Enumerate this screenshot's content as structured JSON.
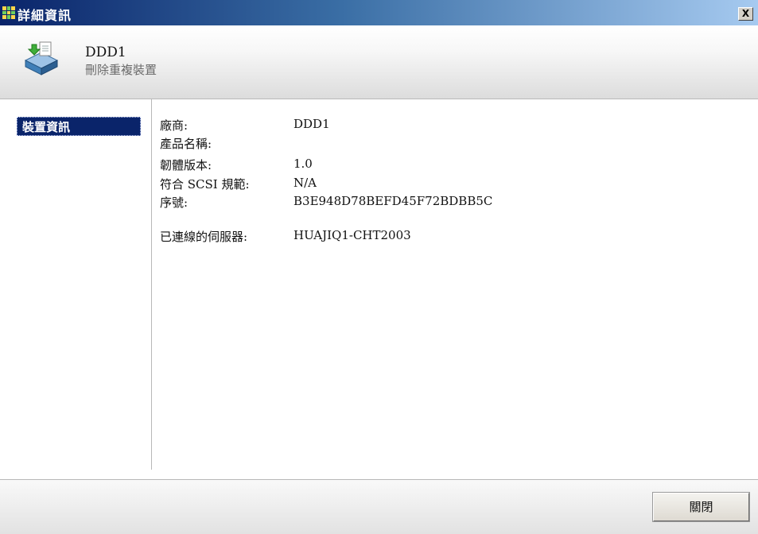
{
  "window": {
    "title": "詳細資訊",
    "close_label": "X"
  },
  "header": {
    "device_name": "DDD1",
    "device_type": "刪除重複裝置",
    "icon": "storage-device-icon"
  },
  "sidebar": {
    "items": [
      {
        "label": "裝置資訊",
        "selected": true
      }
    ]
  },
  "details": {
    "vendor_label": "廠商:",
    "vendor_value": "DDD1",
    "product_label": "產品名稱:",
    "product_value": "",
    "firmware_label": "韌體版本:",
    "firmware_value": "1.0",
    "scsi_label": "符合 SCSI 規範:",
    "scsi_value": "N/A",
    "serial_label": "序號:",
    "serial_value": "B3E948D78BEFD45F72BDBB5C",
    "server_label": "已連線的伺服器:",
    "server_value": "HUAJIQ1-CHT2003"
  },
  "footer": {
    "close_button": "關閉"
  },
  "colors": {
    "titlebar_start": "#0a246a",
    "titlebar_end": "#a6caf0",
    "selection": "#0a246a"
  }
}
